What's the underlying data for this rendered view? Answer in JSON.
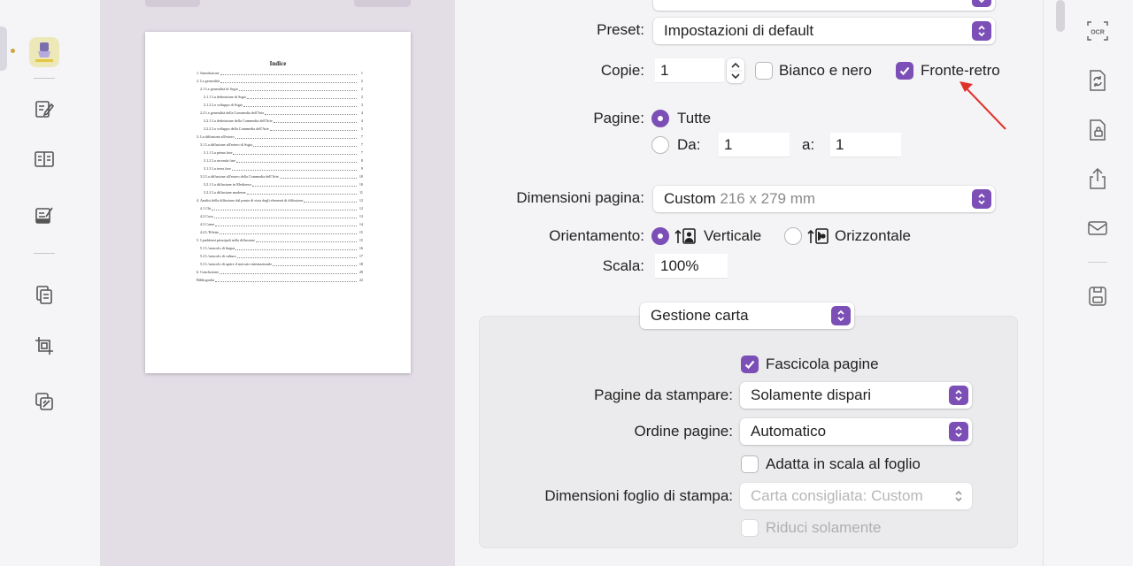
{
  "sidebar": {
    "items": [
      "highlighter-icon",
      "edit-page-icon",
      "reader-icon",
      "annotate-icon",
      "organize-icon",
      "crop-icon",
      "layers-icon"
    ]
  },
  "preview": {
    "toc_title": "Indice",
    "toc": [
      {
        "text": "1. Introduzione",
        "page": "1",
        "indent": 0
      },
      {
        "text": "2. Le generalità",
        "page": "2",
        "indent": 0
      },
      {
        "text": "2.1 Le generalità di Ssgio",
        "page": "2",
        "indent": 1
      },
      {
        "text": "2.1.1 La definizione di Ssgio",
        "page": "2",
        "indent": 2
      },
      {
        "text": "2.1.2 Lo sviluppo di Ssgio",
        "page": "3",
        "indent": 2
      },
      {
        "text": "2.2 Le generalità della Commedia dell'Arte",
        "page": "4",
        "indent": 1
      },
      {
        "text": "2.2.1 La definizione della Commedia dell'Arte",
        "page": "4",
        "indent": 2
      },
      {
        "text": "2.2.2 Lo sviluppo della Commedia dell'Arte",
        "page": "5",
        "indent": 2
      },
      {
        "text": "3. La diffusione all'estero",
        "page": "7",
        "indent": 0
      },
      {
        "text": "3.1 La diffusione all'estero di Ssgio",
        "page": "7",
        "indent": 1
      },
      {
        "text": "3.1.1 La prima fase",
        "page": "7",
        "indent": 2
      },
      {
        "text": "3.1.2 La seconda fase",
        "page": "8",
        "indent": 2
      },
      {
        "text": "3.1.3 La terza fase",
        "page": "9",
        "indent": 2
      },
      {
        "text": "3.2 La diffusione all'estero della Commedia dell'Arte",
        "page": "10",
        "indent": 1
      },
      {
        "text": "3.2.1 La diffusione in Medioevo",
        "page": "10",
        "indent": 2
      },
      {
        "text": "3.2.2 La diffusione moderna",
        "page": "11",
        "indent": 2
      },
      {
        "text": "4. Analisi della diffusione dal punto di vista degli elementi di diffusione",
        "page": "12",
        "indent": 0
      },
      {
        "text": "4.1 Chi",
        "page": "12",
        "indent": 1
      },
      {
        "text": "4.2 Cosa",
        "page": "13",
        "indent": 1
      },
      {
        "text": "4.3 Come",
        "page": "14",
        "indent": 1
      },
      {
        "text": "4.4 L'Effetto",
        "page": "15",
        "indent": 1
      },
      {
        "text": "5. I problemi principali nella diffusione",
        "page": "15",
        "indent": 0
      },
      {
        "text": "5.1 L'ostacolo di lingua",
        "page": "16",
        "indent": 1
      },
      {
        "text": "5.2 L'ostacolo di cultura",
        "page": "17",
        "indent": 1
      },
      {
        "text": "5.3 L'ostacolo di aprire il mercato internazionale",
        "page": "18",
        "indent": 1
      },
      {
        "text": "6. Conclusione",
        "page": "20",
        "indent": 0
      },
      {
        "text": "Bibliografia",
        "page": "22",
        "indent": 0
      }
    ]
  },
  "dialog": {
    "preset_label": "Preset:",
    "preset_value": "Impostazioni di default",
    "copies_label": "Copie:",
    "copies_value": "1",
    "bw_label": "Bianco e nero",
    "bw_checked": false,
    "duplex_label": "Fronte-retro",
    "duplex_checked": true,
    "pages_label": "Pagine:",
    "pages_all_label": "Tutte",
    "pages_from_label": "Da:",
    "pages_from_value": "1",
    "pages_to_label": "a:",
    "pages_to_value": "1",
    "paper_size_label": "Dimensioni pagina:",
    "paper_size_value": "Custom",
    "paper_size_detail": "216 x 279 mm",
    "orientation_label": "Orientamento:",
    "orientation_portrait_label": "Verticale",
    "orientation_landscape_label": "Orizzontale",
    "scale_label": "Scala:",
    "scale_value": "100%",
    "section_value": "Gestione carta",
    "collate_label": "Fascicola pagine",
    "collate_checked": true,
    "pages_to_print_label": "Pagine da stampare:",
    "pages_to_print_value": "Solamente dispari",
    "page_order_label": "Ordine pagine:",
    "page_order_value": "Automatico",
    "fit_label": "Adatta in scala al foglio",
    "fit_checked": false,
    "dest_paper_label": "Dimensioni foglio di stampa:",
    "dest_paper_value": "Carta consigliata: Custom",
    "reduce_label": "Riduci solamente",
    "accent": "#7b4fb6",
    "annotation_color": "#e0302a"
  },
  "toolbar": {
    "items": [
      "ocr-icon",
      "convert-icon",
      "protect-icon",
      "share-icon",
      "mail-icon",
      "save-icon"
    ]
  }
}
